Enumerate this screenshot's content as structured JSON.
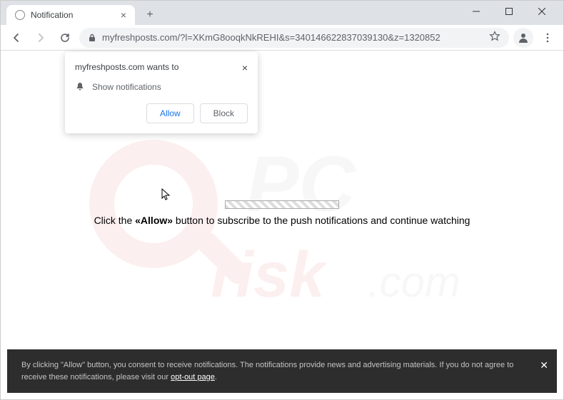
{
  "tab": {
    "title": "Notification"
  },
  "url": "myfreshposts.com/?l=XKmG8ooqkNkREHI&s=340146622837039130&z=1320852",
  "notification": {
    "origin": "myfreshposts.com wants to",
    "line": "Show notifications",
    "allow": "Allow",
    "block": "Block"
  },
  "page": {
    "message_pre": "Click the ",
    "message_bold": "«Allow»",
    "message_post": " button to subscribe to the push notifications and continue watching"
  },
  "banner": {
    "text_pre": "By clicking \"Allow\" button, you consent to receive notifications. The notifications provide news and advertising materials. If you do not agree to receive these notifications, please visit our ",
    "link": "opt-out page",
    "text_post": "."
  },
  "watermark": "PC risk.com"
}
